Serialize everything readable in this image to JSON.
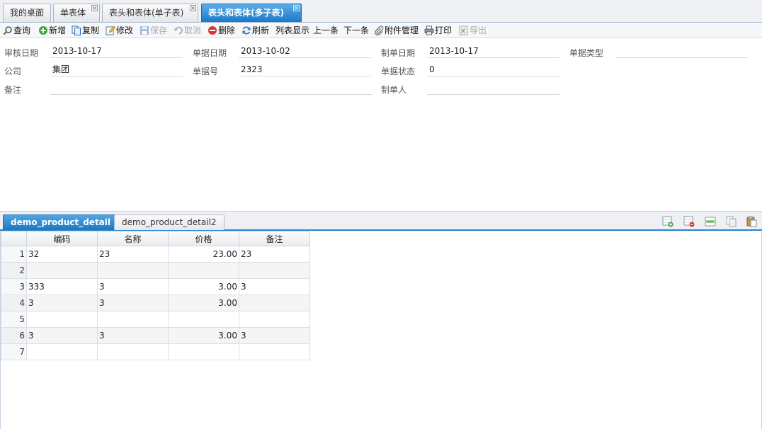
{
  "window_tabs": [
    {
      "label": "我的桌面",
      "active": false,
      "closable": false
    },
    {
      "label": "单表体",
      "active": false,
      "closable": true
    },
    {
      "label": "表头和表体(单子表)",
      "active": false,
      "closable": true
    },
    {
      "label": "表头和表体(多子表)",
      "active": true,
      "closable": true
    }
  ],
  "toolbar": {
    "query": "查询",
    "add": "新增",
    "copy": "复制",
    "edit": "修改",
    "save": "保存",
    "cancel": "取消",
    "delete": "删除",
    "refresh": "刷新",
    "list_view": "列表显示",
    "prev": "上一条",
    "next": "下一条",
    "attachments": "附件管理",
    "print": "打印",
    "export": "导出"
  },
  "form": {
    "audit_date_label": "审核日期",
    "audit_date": "2013-10-17",
    "doc_date_label": "单据日期",
    "doc_date": "2013-10-02",
    "create_date_label": "制单日期",
    "create_date": "2013-10-17",
    "doc_type_label": "单据类型",
    "doc_type": "",
    "company_label": "公司",
    "company": "集团",
    "doc_no_label": "单据号",
    "doc_no": "2323",
    "doc_status_label": "单据状态",
    "doc_status": "0",
    "remark_label": "备注",
    "remark": "",
    "creator_label": "制单人",
    "creator": ""
  },
  "detail_tabs": [
    {
      "label": "demo_product_detail",
      "active": true
    },
    {
      "label": "demo_product_detail2",
      "active": false
    }
  ],
  "grid": {
    "columns": [
      "编码",
      "名称",
      "价格",
      "备注"
    ],
    "rows": [
      {
        "n": "1",
        "code": "32",
        "name": "23",
        "price": "23.00",
        "remark": "23"
      },
      {
        "n": "2",
        "code": "",
        "name": "",
        "price": "",
        "remark": ""
      },
      {
        "n": "3",
        "code": "333",
        "name": "3",
        "price": "3.00",
        "remark": "3"
      },
      {
        "n": "4",
        "code": "3",
        "name": "3",
        "price": "3.00",
        "remark": ""
      },
      {
        "n": "5",
        "code": "",
        "name": "",
        "price": "",
        "remark": ""
      },
      {
        "n": "6",
        "code": "3",
        "name": "3",
        "price": "3.00",
        "remark": "3"
      },
      {
        "n": "7",
        "code": "",
        "name": "",
        "price": "",
        "remark": ""
      }
    ]
  },
  "colors": {
    "accent": "#1c79c6",
    "border": "#c7d3e0"
  }
}
